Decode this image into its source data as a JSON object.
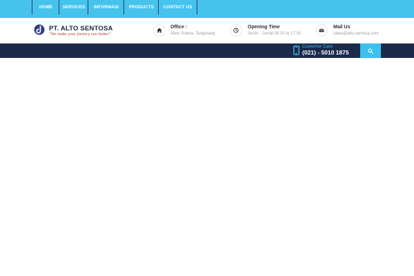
{
  "colors": {
    "topbar": "#45c3ec",
    "nav_bg": "#1b2a4a",
    "accent": "#3cc1ee",
    "logo": "#2e3a8c",
    "tagline": "#c0392b"
  },
  "logo": {
    "title": "PT. ALTO SENTOSA",
    "tagline": "\"We make your factory run better\"",
    "icon": "logo-mark-icon"
  },
  "contact": {
    "office": {
      "title": "Office :",
      "text": "Alam Sutera, Tangerang",
      "icon": "home-icon"
    },
    "opening": {
      "title": "Opening Time",
      "text": "Senin - Jumat 08.30 to 17.00",
      "icon": "clock-icon"
    },
    "mail": {
      "title": "Mail Us",
      "text": "sales@alto-sentosa.com",
      "icon": "envelope-icon"
    }
  },
  "nav": {
    "items": [
      "HOME",
      "SERVICES",
      "INFORMASI",
      "PRODUCTS",
      "CONTACT US"
    ]
  },
  "customer_care": {
    "label": "Customer Care",
    "number": "(021) - 5010 1875",
    "icon": "mobile-phone-icon"
  },
  "search": {
    "icon": "search-icon"
  }
}
